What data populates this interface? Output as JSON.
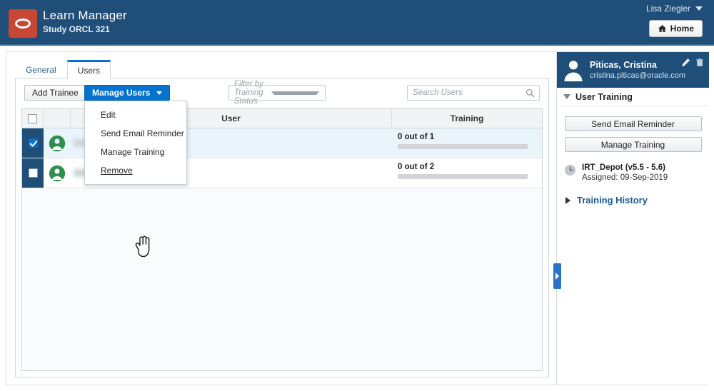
{
  "header": {
    "logo_icon": "oracle-logo-icon",
    "title": "Learn Manager",
    "subtitle": "Study ORCL 321",
    "user_name": "Lisa Ziegler",
    "home_label": "Home",
    "home_icon": "home-icon",
    "brand_color": "#1f4e79",
    "logo_color": "#c74634"
  },
  "tabs": [
    {
      "label": "General",
      "active": false
    },
    {
      "label": "Users",
      "active": true
    }
  ],
  "toolbar": {
    "add_trainee_label": "Add Trainee",
    "manage_users_label": "Manage Users",
    "filter_placeholder": "Filter by Training Status",
    "search_placeholder": "Search Users",
    "search_icon": "search-icon",
    "primary_color": "#0572ce"
  },
  "dropdown": {
    "items": [
      {
        "label": "Edit",
        "hover": false
      },
      {
        "label": "Send Email Reminder",
        "hover": false
      },
      {
        "label": "Manage Training",
        "hover": false
      },
      {
        "label": "Remove",
        "hover": true
      }
    ]
  },
  "table": {
    "columns": [
      "",
      "",
      "User",
      "Training"
    ],
    "header_user": "User",
    "header_training": "Training",
    "select_all_checked": false,
    "rows": [
      {
        "checked": true,
        "selected": true,
        "avatar_icon": "user-avatar-icon",
        "user_name": "",
        "progress_label": "0 out of 1",
        "progress_percent": 0
      },
      {
        "checked": false,
        "selected": false,
        "avatar_icon": "user-avatar-icon",
        "user_name": "",
        "progress_label": "0 out of 2",
        "progress_percent": 0
      }
    ]
  },
  "sidebar": {
    "avatar_icon": "user-avatar-icon",
    "person_name": "Piticas, Cristina",
    "person_email": "cristina.piticas@oracle.com",
    "edit_icon": "pencil-icon",
    "delete_icon": "trash-icon",
    "section_title": "User Training",
    "buttons": [
      {
        "label": "Send Email Reminder"
      },
      {
        "label": "Manage Training"
      }
    ],
    "training_items": [
      {
        "icon": "clock-icon",
        "title": "IRT_Depot (v5.5 - 5.6)",
        "subtitle": "Assigned: 09-Sep-2019"
      }
    ],
    "history_label": "Training History",
    "history_expanded": false,
    "collapse_handle_icon": "chevron-right-icon"
  }
}
